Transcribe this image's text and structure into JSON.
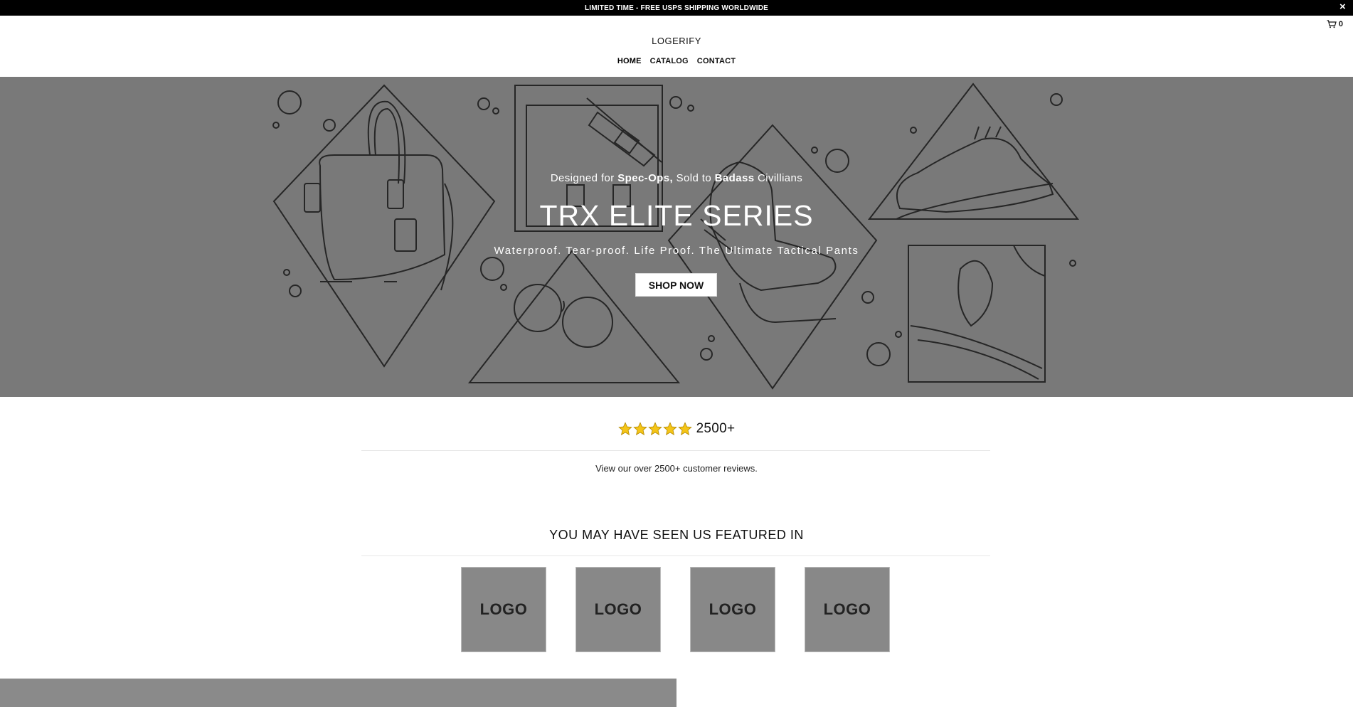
{
  "announcement": {
    "text": "LIMITED TIME - FREE USPS SHIPPING WORLDWIDE",
    "close_label": "×"
  },
  "header": {
    "logo": "LOGERIFY",
    "cart_count": "0",
    "nav": [
      {
        "label": "HOME",
        "active": true
      },
      {
        "label": "CATALOG",
        "active": false
      },
      {
        "label": "CONTACT",
        "active": false
      }
    ]
  },
  "hero": {
    "eyebrow": {
      "part1": "Designed for ",
      "bold1": "Spec-Ops,",
      "part2": " Sold to ",
      "bold2": "Badass",
      "part3": " Civillians"
    },
    "title": "TRX ELITE SERIES",
    "subtitle": "Waterproof. Tear-proof. Life Proof. The Ultimate Tactical Pants",
    "button_label": "SHOP NOW"
  },
  "reviews": {
    "rating": 5,
    "count": "2500+",
    "link_text": "View our over 2500+ customer reviews."
  },
  "featured": {
    "title": "YOU MAY HAVE SEEN US FEATURED IN",
    "logos": [
      "LOGO",
      "LOGO",
      "LOGO",
      "LOGO"
    ]
  },
  "colors": {
    "announcement_bg": "#000000",
    "hero_bg": "#797979",
    "star": "#f5c518",
    "logo_box": "#888888"
  }
}
